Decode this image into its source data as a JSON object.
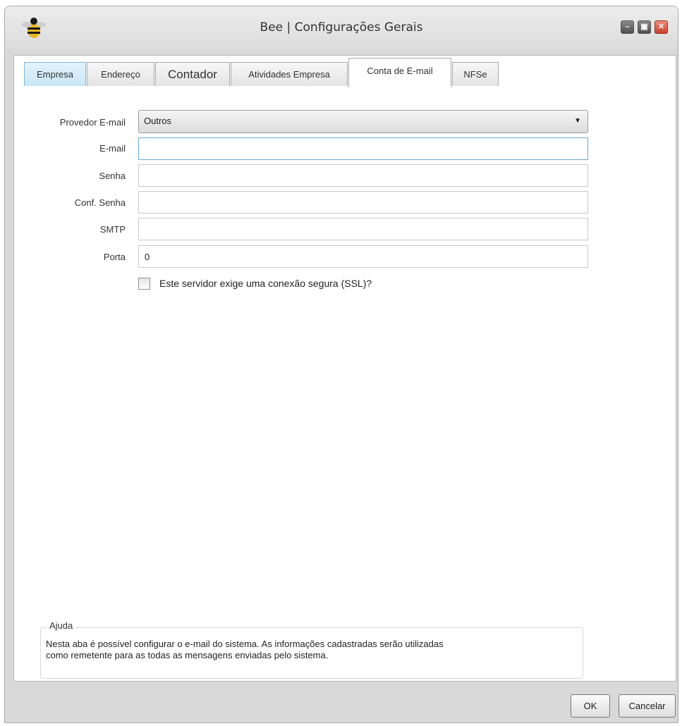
{
  "window": {
    "title": "Bee | Configurações Gerais",
    "controls": {
      "minimize": "–",
      "maximize": "▣",
      "close": "✕"
    }
  },
  "tabs": [
    {
      "label": "Empresa"
    },
    {
      "label": "Endereço"
    },
    {
      "label": "Contador"
    },
    {
      "label": "Atividades Empresa"
    },
    {
      "label": "Conta de E-mail"
    },
    {
      "label": "NFSe"
    }
  ],
  "active_tab": "Conta de E-mail",
  "form": {
    "provider_label": "Provedor E-mail",
    "provider_value": "Outros",
    "email_label": "E-mail",
    "email_value": "",
    "password_label": "Senha",
    "password_value": "",
    "confirm_label": "Conf. Senha",
    "confirm_value": "",
    "smtp_label": "SMTP",
    "smtp_value": "",
    "port_label": "Porta",
    "port_value": "0",
    "ssl_label": "Este servidor exige uma conexão segura (SSL)?",
    "ssl_checked": false
  },
  "help": {
    "title": "Ajuda",
    "line1": "Nesta aba é possível configurar o e-mail do sistema. As informações cadastradas serão utilizadas",
    "line2": "como remetente para as todas as mensagens enviadas pelo sistema."
  },
  "buttons": {
    "ok": "OK",
    "cancel": "Cancelar"
  },
  "icons": {
    "app": "bee-icon",
    "dropdown": "chevron-down-icon"
  },
  "colors": {
    "first_tab_tint": "#c8e6f5",
    "close_button": "#c8402e",
    "focus_border": "#6da8d4"
  }
}
